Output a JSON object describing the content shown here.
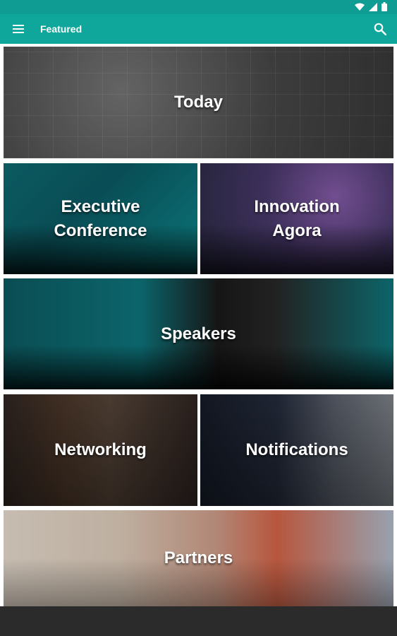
{
  "header": {
    "title": "Featured"
  },
  "tiles": [
    {
      "id": "today",
      "label": "Today"
    },
    {
      "id": "executive-conference",
      "label": "Executive\nConference"
    },
    {
      "id": "innovation-agora",
      "label": "Innovation\nAgora"
    },
    {
      "id": "speakers",
      "label": "Speakers"
    },
    {
      "id": "networking",
      "label": "Networking"
    },
    {
      "id": "notifications",
      "label": "Notifications"
    },
    {
      "id": "partners",
      "label": "Partners"
    }
  ],
  "colors": {
    "accent": "#0fa69b",
    "statusbar": "#0f9d93",
    "navbar": "#2b2b2b"
  },
  "icons": {
    "menu": "hamburger-menu-icon",
    "search": "search-icon",
    "wifi": "wifi-icon",
    "signal": "signal-icon",
    "battery": "battery-icon"
  }
}
